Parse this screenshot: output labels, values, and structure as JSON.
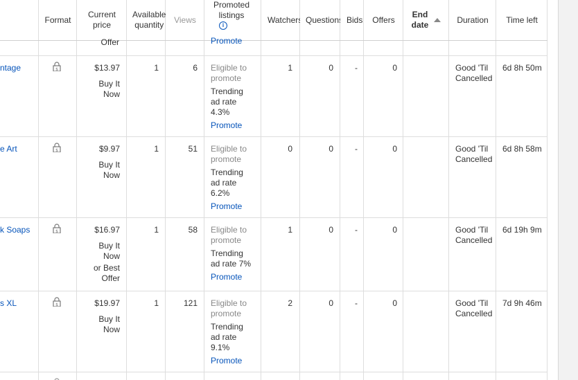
{
  "headers": {
    "format": "Format",
    "price": "Current price",
    "available": "Available quantity",
    "views": "Views",
    "promoted": "Promoted listings",
    "watchers": "Watchers",
    "questions": "Questions",
    "bids": "Bids",
    "offers": "Offers",
    "end_date": "End date",
    "duration": "Duration",
    "time_left": "Time left"
  },
  "top_partial": {
    "price_tail": "Offer",
    "promote": "Promote"
  },
  "rows": [
    {
      "title": "ntage",
      "price": "$13.97",
      "price_type_1": "Buy It",
      "price_type_2": "Now",
      "price_type_3": "",
      "price_type_4": "",
      "available": "1",
      "views": "6",
      "eligible_1": "Eligible to",
      "eligible_2": "promote",
      "trend_1": "Trending",
      "trend_2": "ad rate",
      "trend_3": "4.3%",
      "promote": "Promote",
      "watchers": "1",
      "questions": "0",
      "bids": "-",
      "offers": "0",
      "duration_1": "Good 'Til",
      "duration_2": "Cancelled",
      "time_left": "6d 8h 50m"
    },
    {
      "title": "e Art",
      "price": "$9.97",
      "price_type_1": "Buy It",
      "price_type_2": "Now",
      "price_type_3": "",
      "price_type_4": "",
      "available": "1",
      "views": "51",
      "eligible_1": "Eligible to",
      "eligible_2": "promote",
      "trend_1": "Trending",
      "trend_2": "ad rate",
      "trend_3": "6.2%",
      "promote": "Promote",
      "watchers": "0",
      "questions": "0",
      "bids": "-",
      "offers": "0",
      "duration_1": "Good 'Til",
      "duration_2": "Cancelled",
      "time_left": "6d 8h 58m"
    },
    {
      "title": "k Soaps",
      "price": "$16.97",
      "price_type_1": "Buy It",
      "price_type_2": "Now",
      "price_type_3": "or Best",
      "price_type_4": "Offer",
      "available": "1",
      "views": "58",
      "eligible_1": "Eligible to",
      "eligible_2": "promote",
      "trend_1": "Trending",
      "trend_2": "ad rate 7%",
      "trend_3": "",
      "promote": "Promote",
      "watchers": "1",
      "questions": "0",
      "bids": "-",
      "offers": "0",
      "duration_1": "Good 'Til",
      "duration_2": "Cancelled",
      "time_left": "6d 19h 9m"
    },
    {
      "title": "s XL",
      "price": "$19.97",
      "price_type_1": "Buy It",
      "price_type_2": "Now",
      "price_type_3": "",
      "price_type_4": "",
      "available": "1",
      "views": "121",
      "eligible_1": "Eligible to",
      "eligible_2": "promote",
      "trend_1": "Trending",
      "trend_2": "ad rate",
      "trend_3": "9.1%",
      "promote": "Promote",
      "watchers": "2",
      "questions": "0",
      "bids": "-",
      "offers": "0",
      "duration_1": "Good 'Til",
      "duration_2": "Cancelled",
      "time_left": "7d 9h 46m"
    }
  ]
}
